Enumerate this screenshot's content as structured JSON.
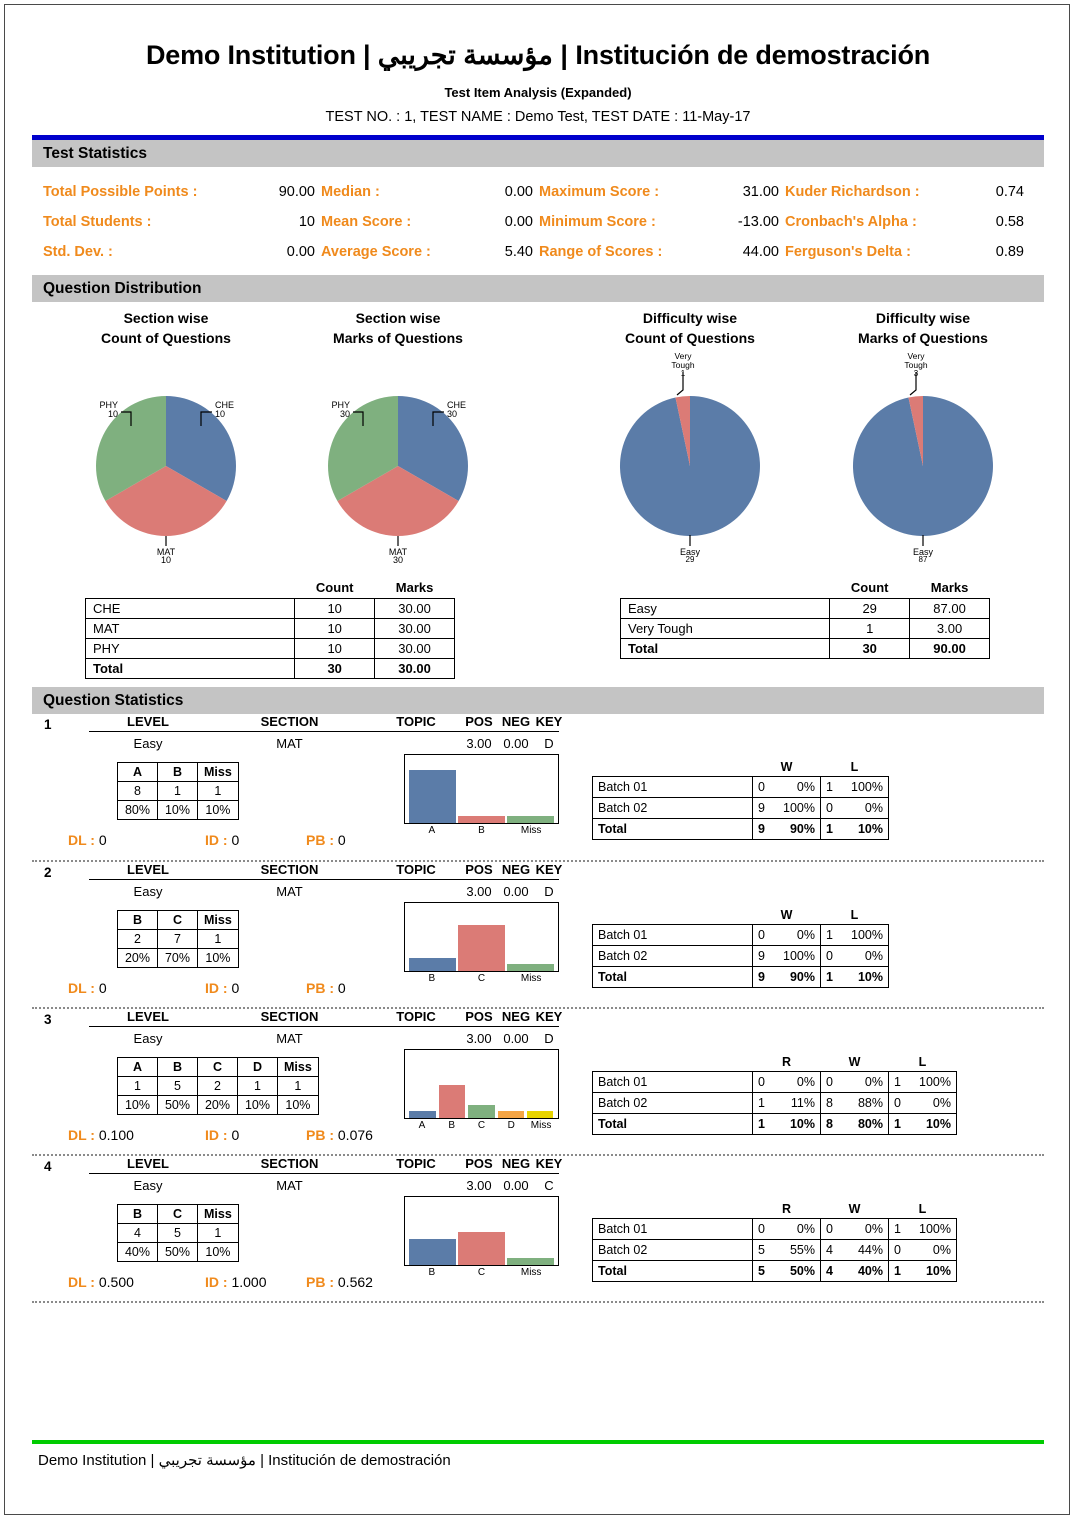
{
  "header": {
    "title": "Demo Institution | مؤسسة تجريبي | Institución de demostración",
    "subtitle": "Test Item Analysis (Expanded)",
    "test_info": "TEST NO. : 1, TEST NAME : Demo Test, TEST DATE : 11-May-17"
  },
  "sections": {
    "test_statistics": "Test Statistics",
    "question_distribution": "Question Distribution",
    "question_statistics": "Question Statistics"
  },
  "test_statistics": [
    {
      "label": "Total Possible Points :",
      "value": "90.00"
    },
    {
      "label": "Median :",
      "value": "0.00"
    },
    {
      "label": "Maximum Score :",
      "value": "31.00"
    },
    {
      "label": "Kuder Richardson :",
      "value": "0.74"
    },
    {
      "label": "Total Students :",
      "value": "10"
    },
    {
      "label": "Mean Score :",
      "value": "0.00"
    },
    {
      "label": "Minimum Score :",
      "value": "-13.00"
    },
    {
      "label": "Cronbach's Alpha :",
      "value": "0.58"
    },
    {
      "label": "Std. Dev. :",
      "value": "0.00"
    },
    {
      "label": "Average Score :",
      "value": "5.40"
    },
    {
      "label": "Range of Scores :",
      "value": "44.00"
    },
    {
      "label": "Ferguson's Delta :",
      "value": "0.89"
    }
  ],
  "chart_data": [
    {
      "type": "pie",
      "title": "Section wise\nCount of Questions",
      "title_line1": "Section wise",
      "title_line2": "Count of Questions",
      "labels": [
        "CHE",
        "MAT",
        "PHY"
      ],
      "values": [
        10,
        10,
        10
      ],
      "value_labels": [
        "10",
        "10",
        "10"
      ],
      "colors": [
        "#5b7ca8",
        "#db7b76",
        "#7fb07f"
      ],
      "legend": "callout labels"
    },
    {
      "type": "pie",
      "title": "Section wise\nMarks of Questions",
      "title_line1": "Section wise",
      "title_line2": "Marks of Questions",
      "labels": [
        "CHE",
        "MAT",
        "PHY"
      ],
      "values": [
        30,
        30,
        30
      ],
      "value_labels": [
        "30",
        "30",
        "30"
      ],
      "colors": [
        "#5b7ca8",
        "#db7b76",
        "#7fb07f"
      ],
      "legend": "callout labels"
    },
    {
      "type": "pie",
      "title": "Difficulty wise\nCount of Questions",
      "title_line1": "Difficulty wise",
      "title_line2": "Count of Questions",
      "labels": [
        "Very Tough",
        "Easy"
      ],
      "values": [
        1,
        29
      ],
      "value_labels": [
        "1",
        "29"
      ],
      "colors": [
        "#db7b76",
        "#5b7ca8"
      ],
      "legend": "callout labels"
    },
    {
      "type": "pie",
      "title": "Difficulty wise\nMarks of Questions",
      "title_line1": "Difficulty wise",
      "title_line2": "Marks of Questions",
      "labels": [
        "Very Tough",
        "Easy"
      ],
      "values": [
        3,
        87
      ],
      "value_labels": [
        "3",
        "87"
      ],
      "colors": [
        "#db7b76",
        "#5b7ca8"
      ],
      "legend": "callout labels"
    },
    {
      "type": "bar",
      "title": "Question 1 option distribution",
      "categories": [
        "A",
        "B",
        "Miss"
      ],
      "values": [
        80,
        10,
        10
      ],
      "colors": [
        "#5b7ca8",
        "#db7b76",
        "#7fb07f"
      ],
      "ylim": [
        0,
        100
      ]
    },
    {
      "type": "bar",
      "title": "Question 2 option distribution",
      "categories": [
        "B",
        "C",
        "Miss"
      ],
      "values": [
        20,
        70,
        10
      ],
      "colors": [
        "#5b7ca8",
        "#db7b76",
        "#7fb07f"
      ],
      "ylim": [
        0,
        100
      ]
    },
    {
      "type": "bar",
      "title": "Question 3 option distribution",
      "categories": [
        "A",
        "B",
        "C",
        "D",
        "Miss"
      ],
      "values": [
        10,
        50,
        20,
        10,
        10
      ],
      "colors": [
        "#5b7ca8",
        "#db7b76",
        "#7fb07f",
        "#f5a544",
        "#e8d400"
      ],
      "ylim": [
        0,
        100
      ]
    },
    {
      "type": "bar",
      "title": "Question 4 option distribution",
      "categories": [
        "B",
        "C",
        "Miss"
      ],
      "values": [
        40,
        50,
        10
      ],
      "colors": [
        "#5b7ca8",
        "#db7b76",
        "#7fb07f"
      ],
      "ylim": [
        0,
        100
      ]
    }
  ],
  "section_table": {
    "headers": [
      "",
      "Count",
      "Marks"
    ],
    "rows": [
      {
        "name": "CHE",
        "count": "10",
        "marks": "30.00"
      },
      {
        "name": "MAT",
        "count": "10",
        "marks": "30.00"
      },
      {
        "name": "PHY",
        "count": "10",
        "marks": "30.00"
      }
    ],
    "total": {
      "name": "Total",
      "count": "30",
      "marks": "30.00"
    }
  },
  "difficulty_table": {
    "headers": [
      "",
      "Count",
      "Marks"
    ],
    "rows": [
      {
        "name": "Easy",
        "count": "29",
        "marks": "87.00"
      },
      {
        "name": "Very Tough",
        "count": "1",
        "marks": "3.00"
      }
    ],
    "total": {
      "name": "Total",
      "count": "30",
      "marks": "90.00"
    }
  },
  "question_headers": {
    "level": "LEVEL",
    "section": "SECTION",
    "topic": "TOPIC",
    "pos": "POS",
    "neg": "NEG",
    "key": "KEY"
  },
  "questions": [
    {
      "num": "1",
      "level": "Easy",
      "section": "MAT",
      "topic": "",
      "pos": "3.00",
      "neg": "0.00",
      "key": "D",
      "options": [
        "A",
        "B",
        "Miss"
      ],
      "counts": [
        "8",
        "1",
        "1"
      ],
      "percents": [
        "80%",
        "10%",
        "10%"
      ],
      "dl_label": "DL :",
      "dl": "0",
      "id_label": "ID :",
      "id": "0",
      "pb_label": "PB :",
      "pb": "0",
      "batch_headers": [
        "W",
        "L"
      ],
      "batches": [
        {
          "name": "Batch 01",
          "cells": [
            {
              "n": "0",
              "p": "0%"
            },
            {
              "n": "1",
              "p": "100%"
            }
          ]
        },
        {
          "name": "Batch 02",
          "cells": [
            {
              "n": "9",
              "p": "100%"
            },
            {
              "n": "0",
              "p": "0%"
            }
          ]
        }
      ],
      "batch_total": {
        "name": "Total",
        "cells": [
          {
            "n": "9",
            "p": "90%"
          },
          {
            "n": "1",
            "p": "10%"
          }
        ]
      }
    },
    {
      "num": "2",
      "level": "Easy",
      "section": "MAT",
      "topic": "",
      "pos": "3.00",
      "neg": "0.00",
      "key": "D",
      "options": [
        "B",
        "C",
        "Miss"
      ],
      "counts": [
        "2",
        "7",
        "1"
      ],
      "percents": [
        "20%",
        "70%",
        "10%"
      ],
      "dl_label": "DL :",
      "dl": "0",
      "id_label": "ID :",
      "id": "0",
      "pb_label": "PB :",
      "pb": "0",
      "batch_headers": [
        "W",
        "L"
      ],
      "batches": [
        {
          "name": "Batch 01",
          "cells": [
            {
              "n": "0",
              "p": "0%"
            },
            {
              "n": "1",
              "p": "100%"
            }
          ]
        },
        {
          "name": "Batch 02",
          "cells": [
            {
              "n": "9",
              "p": "100%"
            },
            {
              "n": "0",
              "p": "0%"
            }
          ]
        }
      ],
      "batch_total": {
        "name": "Total",
        "cells": [
          {
            "n": "9",
            "p": "90%"
          },
          {
            "n": "1",
            "p": "10%"
          }
        ]
      }
    },
    {
      "num": "3",
      "level": "Easy",
      "section": "MAT",
      "topic": "",
      "pos": "3.00",
      "neg": "0.00",
      "key": "D",
      "options": [
        "A",
        "B",
        "C",
        "D",
        "Miss"
      ],
      "counts": [
        "1",
        "5",
        "2",
        "1",
        "1"
      ],
      "percents": [
        "10%",
        "50%",
        "20%",
        "10%",
        "10%"
      ],
      "dl_label": "DL :",
      "dl": "0.100",
      "id_label": "ID :",
      "id": "0",
      "pb_label": "PB :",
      "pb": "0.076",
      "batch_headers": [
        "R",
        "W",
        "L"
      ],
      "batches": [
        {
          "name": "Batch 01",
          "cells": [
            {
              "n": "0",
              "p": "0%"
            },
            {
              "n": "0",
              "p": "0%"
            },
            {
              "n": "1",
              "p": "100%"
            }
          ]
        },
        {
          "name": "Batch 02",
          "cells": [
            {
              "n": "1",
              "p": "11%"
            },
            {
              "n": "8",
              "p": "88%"
            },
            {
              "n": "0",
              "p": "0%"
            }
          ]
        }
      ],
      "batch_total": {
        "name": "Total",
        "cells": [
          {
            "n": "1",
            "p": "10%"
          },
          {
            "n": "8",
            "p": "80%"
          },
          {
            "n": "1",
            "p": "10%"
          }
        ]
      }
    },
    {
      "num": "4",
      "level": "Easy",
      "section": "MAT",
      "topic": "",
      "pos": "3.00",
      "neg": "0.00",
      "key": "C",
      "options": [
        "B",
        "C",
        "Miss"
      ],
      "counts": [
        "4",
        "5",
        "1"
      ],
      "percents": [
        "40%",
        "50%",
        "10%"
      ],
      "dl_label": "DL :",
      "dl": "0.500",
      "id_label": "ID :",
      "id": "1.000",
      "pb_label": "PB :",
      "pb": "0.562",
      "batch_headers": [
        "R",
        "W",
        "L"
      ],
      "batches": [
        {
          "name": "Batch 01",
          "cells": [
            {
              "n": "0",
              "p": "0%"
            },
            {
              "n": "0",
              "p": "0%"
            },
            {
              "n": "1",
              "p": "100%"
            }
          ]
        },
        {
          "name": "Batch 02",
          "cells": [
            {
              "n": "5",
              "p": "55%"
            },
            {
              "n": "4",
              "p": "44%"
            },
            {
              "n": "0",
              "p": "0%"
            }
          ]
        }
      ],
      "batch_total": {
        "name": "Total",
        "cells": [
          {
            "n": "5",
            "p": "50%"
          },
          {
            "n": "4",
            "p": "40%"
          },
          {
            "n": "1",
            "p": "10%"
          }
        ]
      }
    }
  ],
  "footer": {
    "text": "Demo Institution | مؤسسة تجريبي | Institución de demostración"
  },
  "colors": {
    "accent_orange": "#f08a1c",
    "rule_blue": "#0000cc",
    "rule_green": "#00cc00",
    "section_bar": "#c4c4c4",
    "series_blue": "#5b7ca8",
    "series_red": "#db7b76",
    "series_green": "#7fb07f",
    "series_orange": "#f5a544",
    "series_yellow": "#e8d400"
  }
}
